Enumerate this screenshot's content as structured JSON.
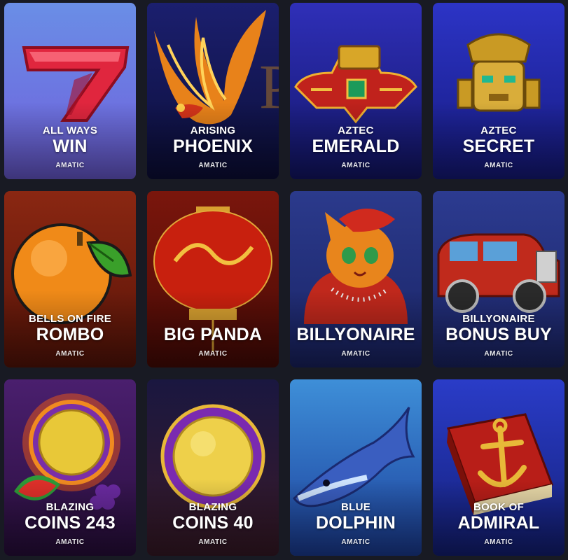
{
  "games": [
    {
      "line1": "ALL WAYS",
      "line2": "WIN",
      "provider": "AMATIC",
      "icon": "seven-icon",
      "bg_top": "#6a8ee6",
      "bg_bottom": "#6f5fdc"
    },
    {
      "line1": "ARISING",
      "line2": "PHOENIX",
      "provider": "AMATIC",
      "icon": "phoenix-icon",
      "bg_top": "#1b1f6e",
      "bg_bottom": "#0c0e3a"
    },
    {
      "line1": "AZTEC",
      "line2": "EMERALD",
      "provider": "AMATIC",
      "icon": "aztec-bird-icon",
      "bg_top": "#2f2fb8",
      "bg_bottom": "#13166b"
    },
    {
      "line1": "AZTEC",
      "line2": "SECRET",
      "provider": "AMATIC",
      "icon": "aztec-mask-icon",
      "bg_top": "#2c34c6",
      "bg_bottom": "#161a80"
    },
    {
      "line1": "BELLS ON FIRE",
      "line2": "ROMBO",
      "provider": "AMATIC",
      "icon": "orange-icon",
      "bg_top": "#8a2712",
      "bg_bottom": "#5a1408"
    },
    {
      "line1": "",
      "line2": "BIG PANDA",
      "provider": "AMATIC",
      "icon": "lantern-icon",
      "bg_top": "#7a160c",
      "bg_bottom": "#4a0a05"
    },
    {
      "line1": "",
      "line2": "BILLYONAIRE",
      "provider": "AMATIC",
      "icon": "cat-icon",
      "bg_top": "#2b3a8c",
      "bg_bottom": "#1a2466"
    },
    {
      "line1": "BILLYONAIRE",
      "line2": "BONUS BUY",
      "provider": "AMATIC",
      "icon": "vintage-car-icon",
      "bg_top": "#2c3b90",
      "bg_bottom": "#1b2568"
    },
    {
      "line1": "BLAZING",
      "line2": "COINS 243",
      "provider": "AMATIC",
      "icon": "coin-fruit-icon",
      "bg_top": "#4a1f6e",
      "bg_bottom": "#2a0e3e"
    },
    {
      "line1": "BLAZING",
      "line2": "COINS 40",
      "provider": "AMATIC",
      "icon": "coin-icon",
      "bg_top": "#1a1740",
      "bg_bottom": "#3a1a28"
    },
    {
      "line1": "BLUE",
      "line2": "DOLPHIN",
      "provider": "AMATIC",
      "icon": "dolphin-icon",
      "bg_top": "#3e8fd8",
      "bg_bottom": "#1c3f9c"
    },
    {
      "line1": "BOOK OF",
      "line2": "ADMIRAL",
      "provider": "AMATIC",
      "icon": "book-anchor-icon",
      "bg_top": "#2a3cc8",
      "bg_bottom": "#14207a"
    }
  ]
}
